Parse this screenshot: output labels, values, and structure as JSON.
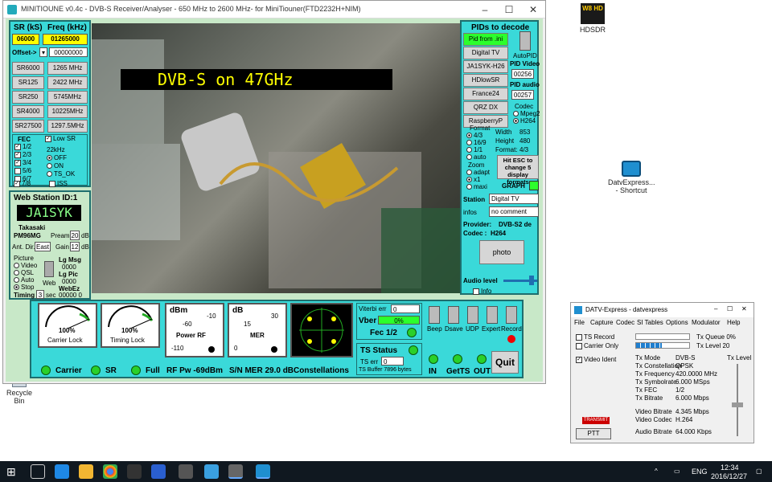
{
  "desktop": {
    "icons": [
      {
        "name": "hdsdr",
        "label": "HDSDR",
        "badge": "W8 HD"
      },
      {
        "name": "datvexpress-shortcut",
        "label": "DatvExpress... - Shortcut"
      },
      {
        "name": "recycle-bin",
        "label": "Recycle Bin"
      }
    ]
  },
  "minitioune": {
    "title": "MINITIOUNE v0.4c - DVB-S Receiver/Analyser - 650 MHz to 2600 MHz- for MiniTiouner(FTD2232H+NIM)",
    "sr_label": "SR (kS)",
    "freq_label": "Freq (kHz)",
    "sr_value": "06000",
    "freq_value": "01265000",
    "offset_label": "Offset->",
    "offset_value": "00000000",
    "sr_buttons": [
      "SR6000",
      "SR125",
      "SR250",
      "SR4000",
      "SR27500"
    ],
    "freq_buttons": [
      "1265 MHz",
      "2422 MHz",
      "5745MHz",
      "10225MHz",
      "1297.5MHz"
    ],
    "fec_label": "FEC",
    "fec_items": [
      "1/2",
      "2/3",
      "3/4",
      "5/6",
      "6/7",
      "7/8"
    ],
    "low_sr": "Low SR",
    "khz22": "22kHz",
    "khz22_opts": [
      "OFF",
      "ON",
      "TS_OK"
    ],
    "iss": "ISS",
    "web_station": "Web Station ID:1",
    "callsign": "JA1SYK",
    "city": "Takasaki",
    "locator": "PM96MG",
    "preamp_label": "Preamp",
    "preamp_value": "20",
    "db": "dB",
    "ant_label": "Ant. Dir.",
    "ant_value": "East",
    "gain_label": "Gain",
    "gain_value": "12",
    "picture_label": "Picture",
    "picture_opts": [
      "Video",
      "QSL",
      "Auto",
      "Stop"
    ],
    "web_label": "Web",
    "lg_msg_label": "Lg Msg",
    "lg_msg_value": "0000",
    "lg_pic_label": "Lg Pic",
    "lg_pic_value": "0000",
    "webez_label": "WebEz",
    "webez_value": "00000 0",
    "timing_label": "Timing",
    "timing_value": "3",
    "sec": "sec",
    "osd_text": "DVB-S on 47GHz",
    "pids_title": "PIDs to decode",
    "pid_buttons": [
      "Pid from .ini",
      "Digital TV",
      "JA1SYK-H26",
      "HDlowSR",
      "France24",
      "QRZ DX",
      "RaspberryP"
    ],
    "autopid": "AutoPID",
    "pid_video_label": "PID Video",
    "pid_video": "00256",
    "pid_audio_label": "PID audio",
    "pid_audio": "00257",
    "codec_label": "Codec",
    "codec_opts": [
      "Mpeg2",
      "H264"
    ],
    "format_label": "Format",
    "format_opts": [
      "4/3",
      "16/9",
      "1/1",
      "auto"
    ],
    "width_label": "Width",
    "width": "853",
    "height_label": "Height",
    "height": "480",
    "format2_label": "Format:",
    "format2": "4/3",
    "zoom_label": "Zoom",
    "zoom_opts": [
      "adapt",
      "x1",
      "maxi"
    ],
    "esc_text": "Hit ESC to change 5 display formats",
    "graph": "GRAPH",
    "station_label": "Station",
    "station_value": "Digital TV",
    "infos_label": "infos",
    "infos_value": "no comment",
    "provider_label": "Provider:",
    "provider_value": "DVB-S2 de",
    "codec2_label": "Codec :",
    "codec2_value": "H264",
    "photo": "photo",
    "audio_label": "Audio level",
    "info": "Info",
    "gauges": [
      {
        "value": "100%",
        "name": "Carrier Lock"
      },
      {
        "value": "100%",
        "name": "Timing Lock"
      }
    ],
    "power_gauge": {
      "unit": "dBm",
      "ticks": [
        "-60",
        "-10",
        "-110"
      ],
      "name": "Power RF"
    },
    "mer_gauge": {
      "unit": "dB",
      "ticks": [
        "15",
        "30",
        "0"
      ],
      "name": "MER"
    },
    "viterbi_label": "Viterbi err",
    "viterbi_value": "0",
    "vber_label": "Vber",
    "vber_value": "0%",
    "fec_status": "Fec 1/2",
    "ts_status": "TS Status",
    "ts_err_label": "TS err",
    "ts_err_value": "0",
    "ts_buffer": "TS Buffer 7896 bytes",
    "toggle_labels": [
      "Beep",
      "Dsave",
      "UDP",
      "Expert",
      "Record"
    ],
    "bottom_labels": {
      "carrier": "Carrier",
      "sr": "SR",
      "full": "Full",
      "rf": "RF Pw -69dBm",
      "mer": "S/N MER  29.0 dB",
      "const": "Constellations",
      "in": "IN",
      "getts": "GetTS",
      "out": "OUT",
      "quit": "Quit"
    }
  },
  "datv": {
    "title": "DATV-Express - datvexpress",
    "menu": [
      "File",
      "Capture",
      "Codec",
      "SI Tables",
      "Options",
      "Modulator",
      "Help"
    ],
    "ts_record": "TS Record",
    "carrier_only": "Carrier Only",
    "video_ident": "Video Ident",
    "queue": "Tx Queue 0%",
    "level": "Tx Level 20",
    "tx_level": "Tx Level",
    "params": [
      [
        "Tx Mode",
        "DVB-S"
      ],
      [
        "Tx Constellation",
        "QPSK"
      ],
      [
        "Tx Frequency",
        "420.0000 MHz"
      ],
      [
        "Tx Symbolrate",
        "6.000 MSps"
      ],
      [
        "Tx FEC",
        "1/2"
      ],
      [
        "Tx Bitrate",
        "6.000 Mbps"
      ],
      [
        "Video Bitrate",
        "4.345 Mbps"
      ],
      [
        "Video Codec",
        "H.264"
      ],
      [
        "Audio Bitrate",
        "64.000 Kbps"
      ]
    ],
    "transmit": "TRANSMIT",
    "ptt": "PTT"
  },
  "taskbar": {
    "lang": "ENG",
    "time": "12:34",
    "date": "2016/12/27"
  }
}
